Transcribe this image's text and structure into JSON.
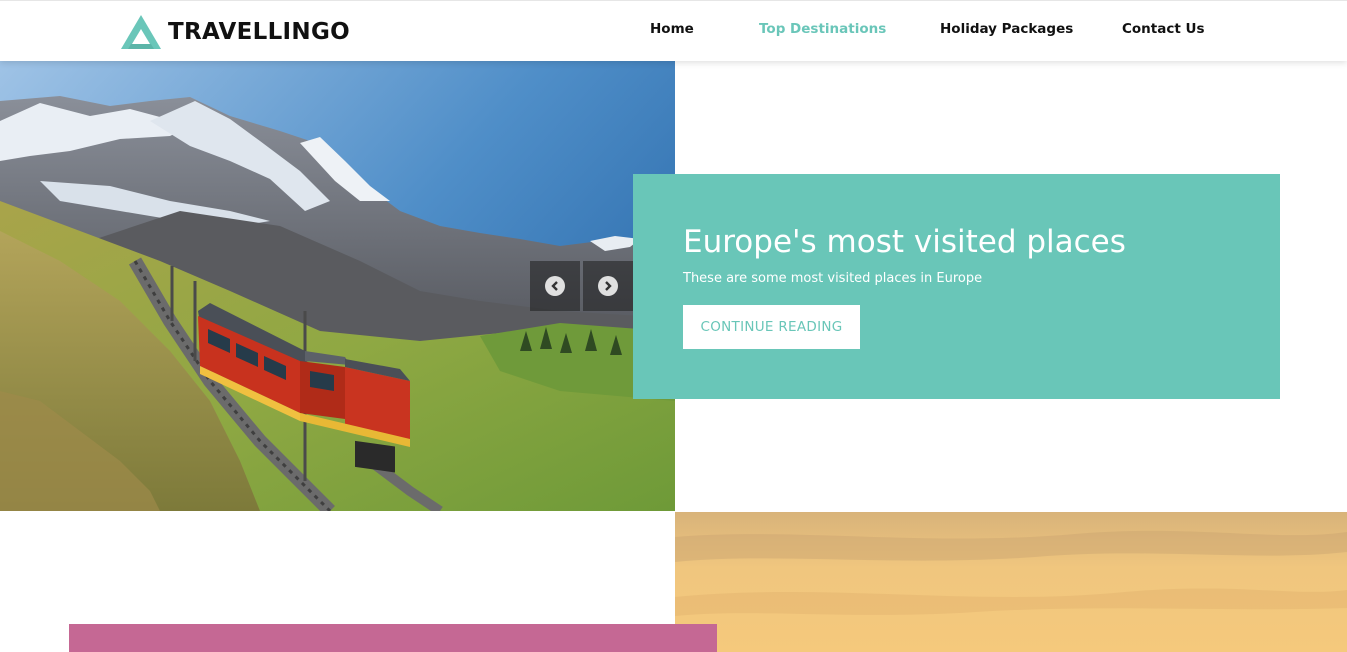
{
  "brand": {
    "name": "TRAVELLINGO",
    "accent_color": "#6ac6b9",
    "logo_icon": "triangle-logo-icon"
  },
  "nav": {
    "items": [
      {
        "label": "Home",
        "active": false
      },
      {
        "label": "Top Destinations",
        "active": true
      },
      {
        "label": "Holiday Packages",
        "active": false
      },
      {
        "label": "Contact Us",
        "active": false
      }
    ]
  },
  "slider": {
    "prev_icon": "chevron-left-circle-icon",
    "next_icon": "chevron-right-circle-icon",
    "card_color": "#69c6b8",
    "title": "Europe's most visited places",
    "subtitle": "These are some most visited places in Europe",
    "button_label": "CONTINUE READING"
  },
  "next_section": {
    "card_color": "#c56894"
  }
}
